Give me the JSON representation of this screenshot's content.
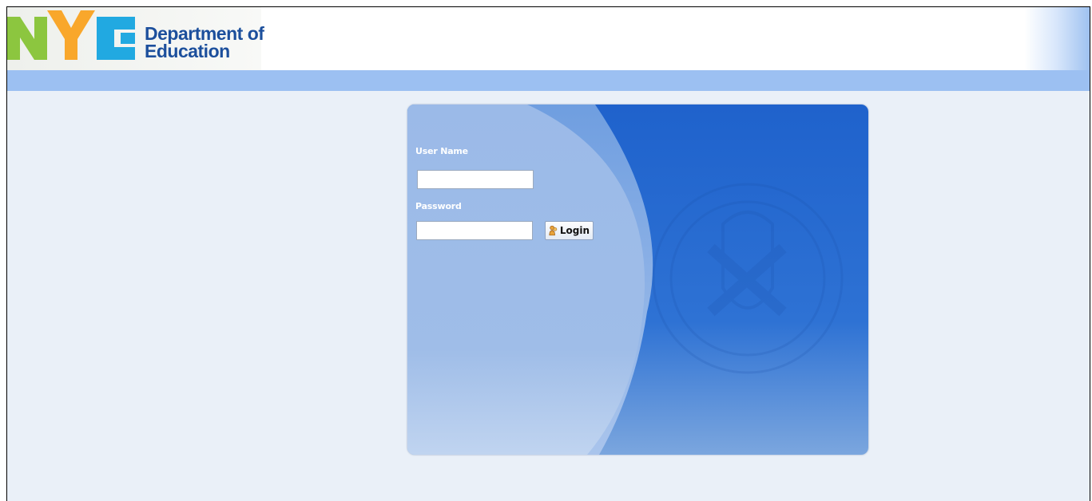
{
  "header": {
    "logo_letters": "NYC",
    "brand_line1": "Department of",
    "brand_line2": "Education",
    "colors": {
      "n": "#8cc63f",
      "y": "#f9a72b",
      "c": "#21a9e1",
      "brand_text": "#1c4f9c"
    }
  },
  "login": {
    "username_label": "User Name",
    "username_value": "",
    "password_label": "Password",
    "password_value": "",
    "login_button_label": "Login",
    "login_icon": "users-icon"
  },
  "colors": {
    "page_background": "#eaf0f8",
    "header_stripe": "#9cc0f2",
    "panel_blue": "#2a6fd0",
    "panel_light": "#9bbbe8"
  }
}
